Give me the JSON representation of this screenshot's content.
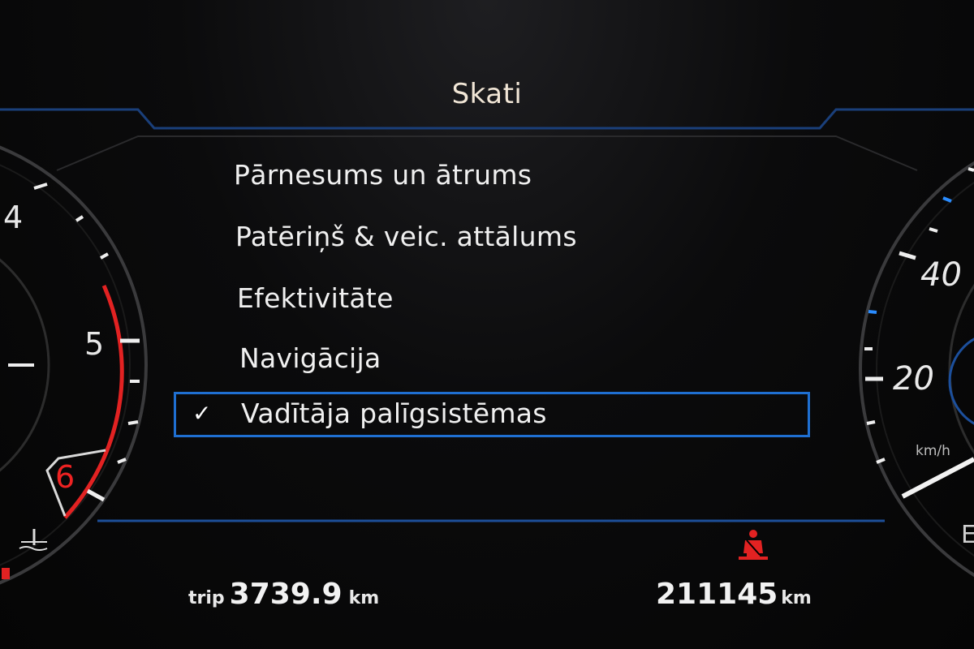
{
  "screen": {
    "title": "Skati"
  },
  "menu": {
    "items": [
      {
        "label": "Pārnesums un ātrums",
        "selected": false
      },
      {
        "label": "Patēriņš & veic. attālums",
        "selected": false
      },
      {
        "label": "Efektivitāte",
        "selected": false
      },
      {
        "label": "Navigācija",
        "selected": false
      },
      {
        "label": "Vadītāja palīgsistēmas",
        "selected": true
      }
    ],
    "check_symbol": "✓"
  },
  "tachometer": {
    "labels": [
      "4",
      "5",
      "6"
    ]
  },
  "speedometer": {
    "labels": [
      "40",
      "20"
    ],
    "unit": "km/h",
    "side_letter": "E"
  },
  "footer": {
    "trip_label": "trip",
    "trip_value": "3739.9",
    "trip_unit": "km",
    "odometer_value": "211145",
    "odometer_unit": "km"
  },
  "indicators": {
    "seatbelt_warning": "seatbelt-icon",
    "coolant": "coolant-temperature-icon"
  },
  "colors": {
    "accent_blue": "#1f6fd1",
    "redline": "#e22222",
    "title": "#f1e6d6"
  }
}
